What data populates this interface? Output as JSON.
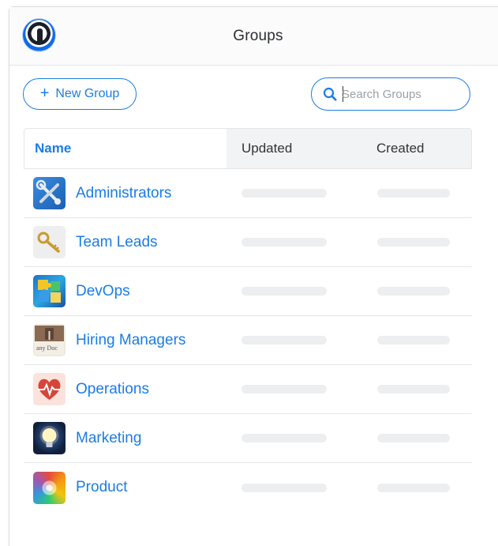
{
  "header": {
    "title": "Groups",
    "logo_icon": "1password-logo-icon"
  },
  "toolbar": {
    "new_group_label": "New Group",
    "search_placeholder": "Search Groups",
    "search_value": ""
  },
  "table": {
    "columns": [
      "Name",
      "Updated",
      "Created"
    ],
    "rows": [
      {
        "name": "Administrators",
        "icon": "tools-icon"
      },
      {
        "name": "Team Leads",
        "icon": "keys-icon"
      },
      {
        "name": "DevOps",
        "icon": "puzzle-icon"
      },
      {
        "name": "Hiring Managers",
        "icon": "document-clip-icon"
      },
      {
        "name": "Operations",
        "icon": "heart-pulse-icon"
      },
      {
        "name": "Marketing",
        "icon": "lightbulb-icon"
      },
      {
        "name": "Product",
        "icon": "color-wheel-icon"
      }
    ]
  },
  "colors": {
    "accent": "#1a7de6",
    "border": "#e3e5e8",
    "placeholder_bar": "#edeef0"
  }
}
